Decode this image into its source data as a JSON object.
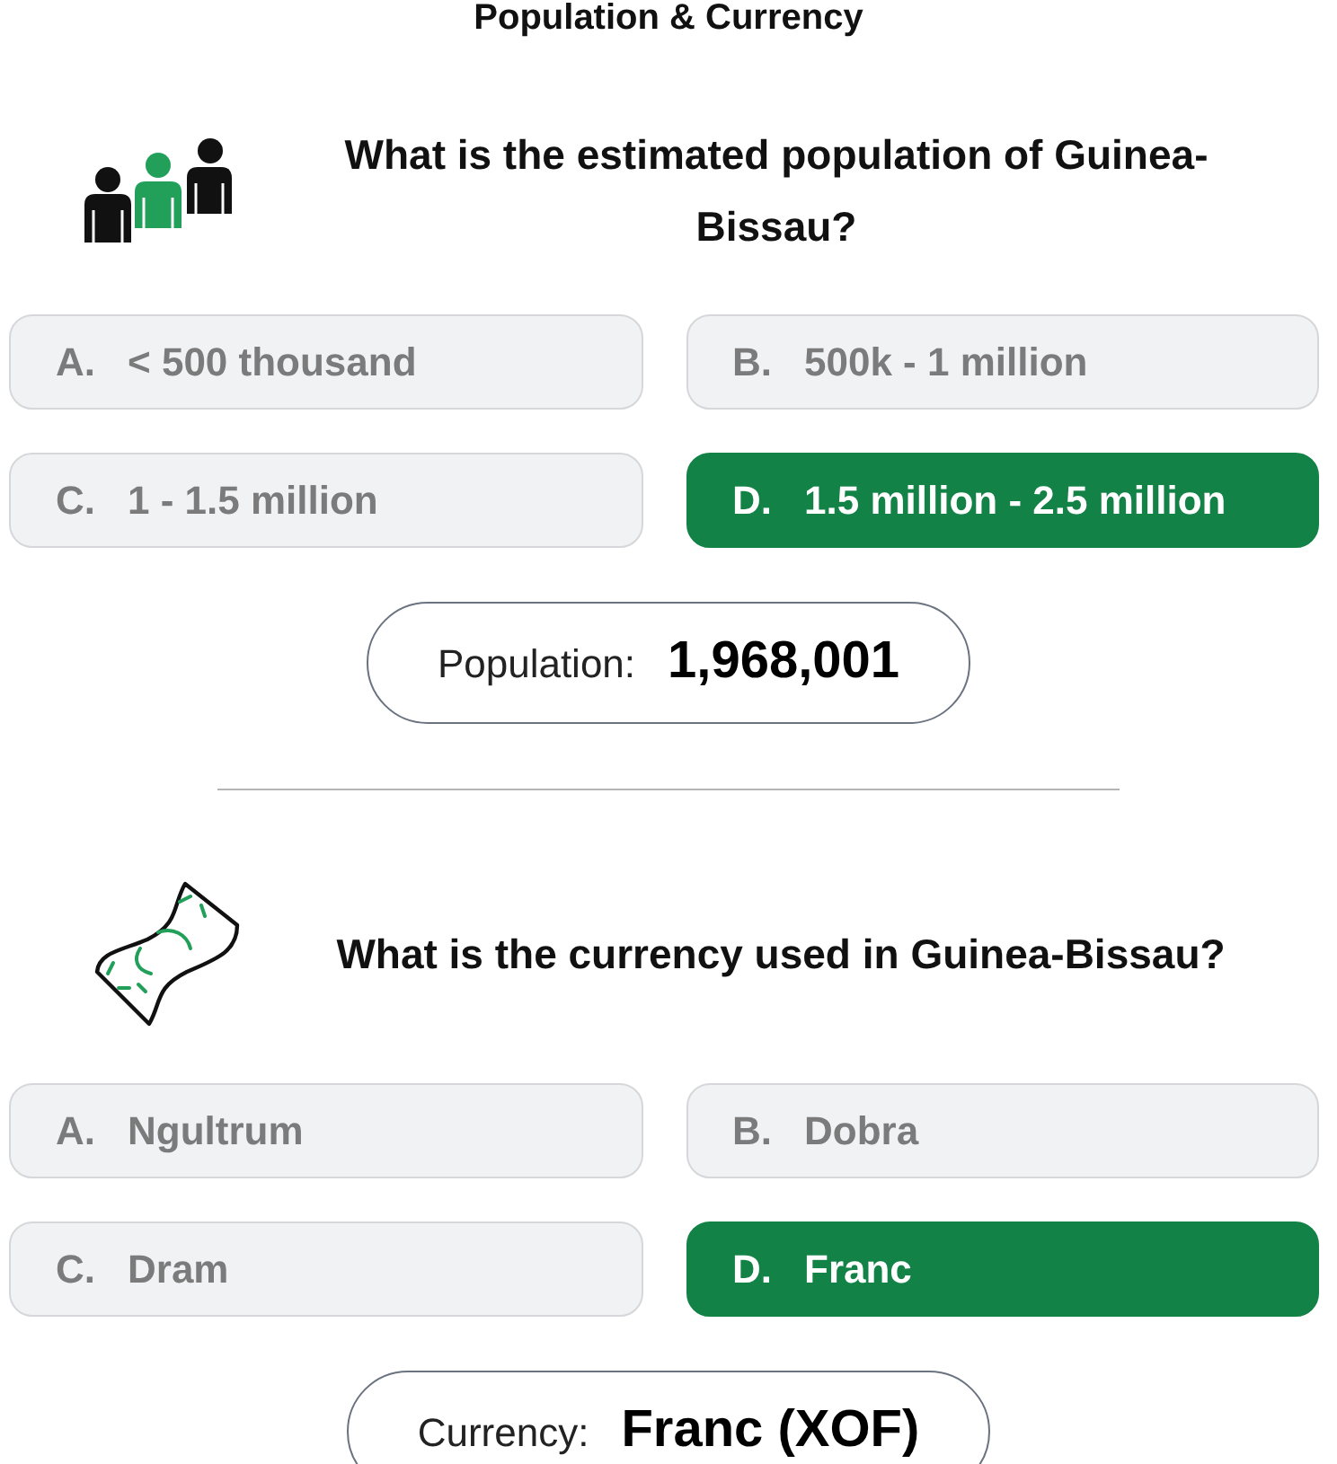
{
  "title": "Population & Currency",
  "sections": [
    {
      "kind": "population",
      "question": "What is the estimated population of Guinea-Bissau?",
      "options": [
        {
          "letter": "A.",
          "text": "< 500 thousand",
          "selected": false
        },
        {
          "letter": "B.",
          "text": "500k - 1 million",
          "selected": false
        },
        {
          "letter": "C.",
          "text": "1 - 1.5 million",
          "selected": false
        },
        {
          "letter": "D.",
          "text": "1.5 million - 2.5 million",
          "selected": true
        }
      ],
      "answer": {
        "label": "Population:",
        "value": "1,968,001"
      }
    },
    {
      "kind": "currency",
      "question": "What is the currency used in Guinea-Bissau?",
      "options": [
        {
          "letter": "A.",
          "text": "Ngultrum",
          "selected": false
        },
        {
          "letter": "B.",
          "text": "Dobra",
          "selected": false
        },
        {
          "letter": "C.",
          "text": "Dram",
          "selected": false
        },
        {
          "letter": "D.",
          "text": "Franc",
          "selected": true
        }
      ],
      "answer": {
        "label": "Currency:",
        "value": "Franc (XOF)"
      }
    }
  ]
}
